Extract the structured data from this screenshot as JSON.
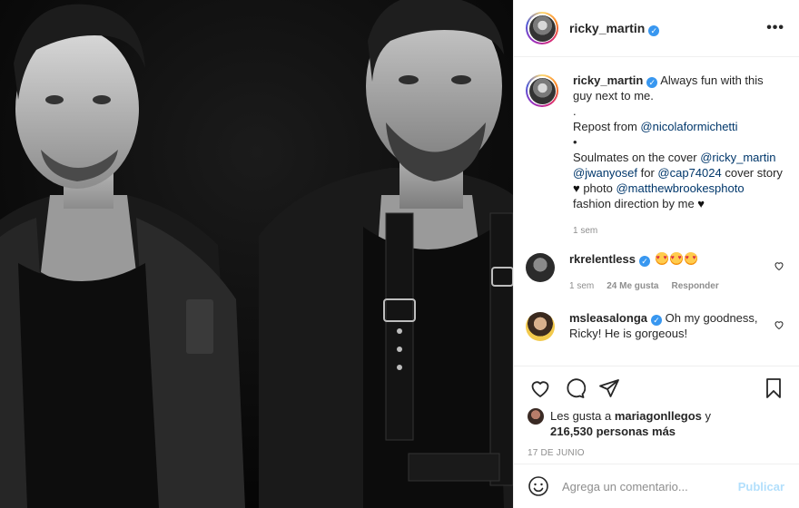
{
  "post": {
    "username": "ricky_martin",
    "more_icon": "more-horizontal-icon"
  },
  "caption": {
    "username": "ricky_martin",
    "line1": "Always fun with this guy next to me.",
    "dot1": ".",
    "repost_prefix": "Repost from ",
    "repost_mention": "@nicolaformichetti",
    "dot2": "•",
    "soulmates": "Soulmates on the cover ",
    "mention1": "@ricky_martin",
    "mention2": "@jwanyosef",
    "for_text": " for ",
    "mention3": "@cap74024",
    "cover_story": " cover story ",
    "photo_text": " photo ",
    "mention4": "@matthewbrookesphoto",
    "fashion": " fashion direction by me ",
    "time": "1 sem"
  },
  "comments": [
    {
      "username": "rkrelentless",
      "text": "",
      "time": "1 sem",
      "likes": "24 Me gusta",
      "reply": "Responder"
    },
    {
      "username": "msleasalonga",
      "text": "Oh my goodness, Ricky! He is gorgeous!"
    }
  ],
  "likes": {
    "prefix": "Les gusta a ",
    "user": "mariagonllegos",
    "conjunction": " y",
    "count": "216,530 personas más"
  },
  "date": "17 DE JUNIO",
  "composer": {
    "placeholder": "Agrega un comentario...",
    "publish": "Publicar"
  },
  "colors": {
    "verified": "#3897f0",
    "mention": "#00376b",
    "publish_disabled": "#b2dffc",
    "meta_gray": "#8e8e8e"
  }
}
